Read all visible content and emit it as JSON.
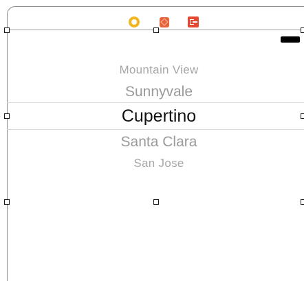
{
  "scene": {
    "dock_icons": [
      "view-controller-icon",
      "first-responder-icon",
      "exit-icon"
    ],
    "status_bar_icon": "battery-icon"
  },
  "picker": {
    "options": [
      "Mountain View",
      "Sunnyvale",
      "Cupertino",
      "Santa Clara",
      "San Jose"
    ],
    "selected_index": 2,
    "selected": "Cupertino"
  }
}
